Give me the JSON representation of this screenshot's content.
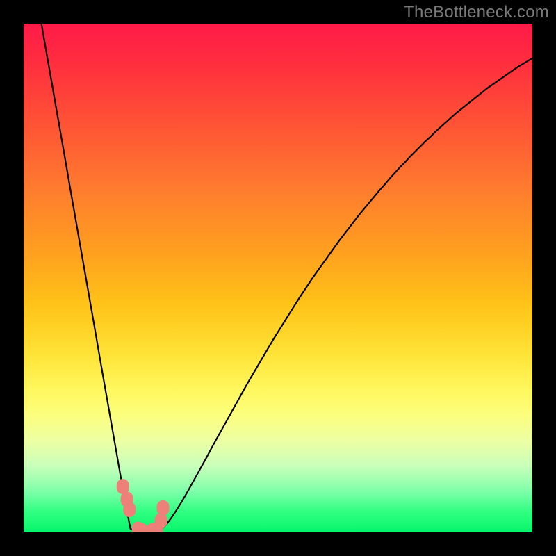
{
  "watermark": "TheBottleneck.com",
  "chart_data": {
    "type": "line",
    "title": "",
    "xlabel": "",
    "ylabel": "",
    "xlim": [
      0,
      100
    ],
    "ylim": [
      0,
      100
    ],
    "x": [
      0,
      1,
      2,
      3,
      4,
      5,
      6,
      7,
      8,
      9,
      10,
      11,
      12,
      13,
      14,
      15,
      16,
      17,
      18,
      19,
      20,
      21,
      22,
      23,
      24,
      25,
      26,
      27,
      28,
      29,
      30,
      31,
      32,
      33,
      34,
      35,
      36,
      37,
      38,
      39,
      40,
      41,
      42,
      43,
      44,
      45,
      46,
      47,
      48,
      49,
      50,
      51,
      52,
      53,
      54,
      55,
      56,
      57,
      58,
      59,
      60,
      61,
      62,
      63,
      64,
      65,
      66,
      67,
      68,
      69,
      70,
      71,
      72,
      73,
      74,
      75,
      76,
      77,
      78,
      79,
      80,
      81,
      82,
      83,
      84,
      85,
      86,
      87,
      88,
      89,
      90,
      91,
      92,
      93,
      94,
      95,
      96,
      97,
      98,
      99,
      100
    ],
    "values": [
      120.0,
      114.3,
      108.6,
      102.9,
      97.1,
      91.4,
      85.7,
      80.0,
      74.3,
      68.5,
      62.8,
      57.1,
      51.4,
      45.7,
      40.0,
      34.2,
      28.5,
      22.8,
      17.1,
      11.4,
      5.7,
      0.7,
      0.2,
      0.0,
      0.0,
      0.0,
      0.1,
      0.5,
      1.5,
      2.8,
      4.3,
      5.9,
      7.6,
      9.4,
      11.2,
      13.0,
      14.8,
      16.7,
      18.5,
      20.3,
      22.1,
      23.9,
      25.7,
      27.5,
      29.3,
      31.0,
      32.7,
      34.4,
      36.1,
      37.8,
      39.4,
      41.0,
      42.6,
      44.2,
      45.8,
      47.3,
      48.8,
      50.3,
      51.7,
      53.1,
      54.5,
      55.9,
      57.3,
      58.6,
      59.9,
      61.2,
      62.5,
      63.7,
      64.9,
      66.1,
      67.3,
      68.4,
      69.6,
      70.7,
      71.8,
      72.8,
      73.9,
      74.9,
      75.9,
      76.9,
      77.8,
      78.8,
      79.7,
      80.6,
      81.5,
      82.4,
      83.2,
      84.0,
      84.8,
      85.6,
      86.4,
      87.2,
      87.9,
      88.6,
      89.3,
      90.0,
      90.7,
      91.4,
      92.0,
      92.6,
      93.2
    ],
    "markers": {
      "x": [
        19.5,
        20.3,
        20.8,
        22.5,
        23.2,
        25.3,
        26.2,
        27.0,
        27.4
      ],
      "y": [
        9.0,
        6.5,
        4.5,
        0.6,
        0.3,
        0.3,
        0.6,
        2.3,
        4.8
      ]
    }
  }
}
